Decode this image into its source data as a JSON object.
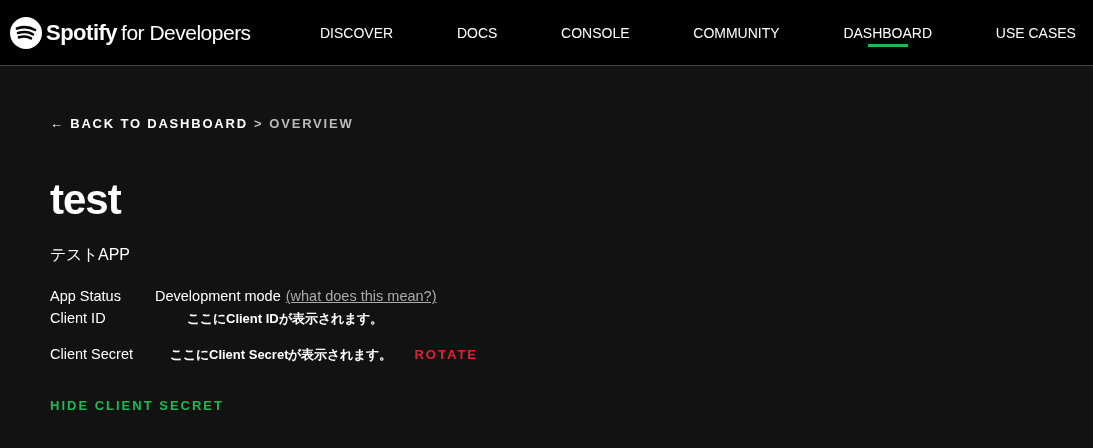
{
  "header": {
    "brand": "Spotify",
    "brand_suffix": "for Developers",
    "nav": [
      {
        "label": "DISCOVER",
        "selected": false
      },
      {
        "label": "DOCS",
        "selected": false
      },
      {
        "label": "CONSOLE",
        "selected": false
      },
      {
        "label": "COMMUNITY",
        "selected": false
      },
      {
        "label": "DASHBOARD",
        "selected": true
      },
      {
        "label": "USE CASES",
        "selected": false
      }
    ]
  },
  "breadcrumb": {
    "back": "← BACK TO DASHBOARD",
    "separator": ">",
    "current": "OVERVIEW"
  },
  "app": {
    "name": "test",
    "description": "テストAPP"
  },
  "details": [
    {
      "label": "App Status",
      "value": "Development mode",
      "link": "(what does this mean?)"
    },
    {
      "label": "Client ID",
      "value": "ここにClient IDが表示されます。"
    },
    {
      "label": "Client Secret",
      "value": "ここにClient Secretが表示されます。",
      "action": "ROTATE"
    }
  ],
  "hide_button": "HIDE CLIENT SECRET"
}
